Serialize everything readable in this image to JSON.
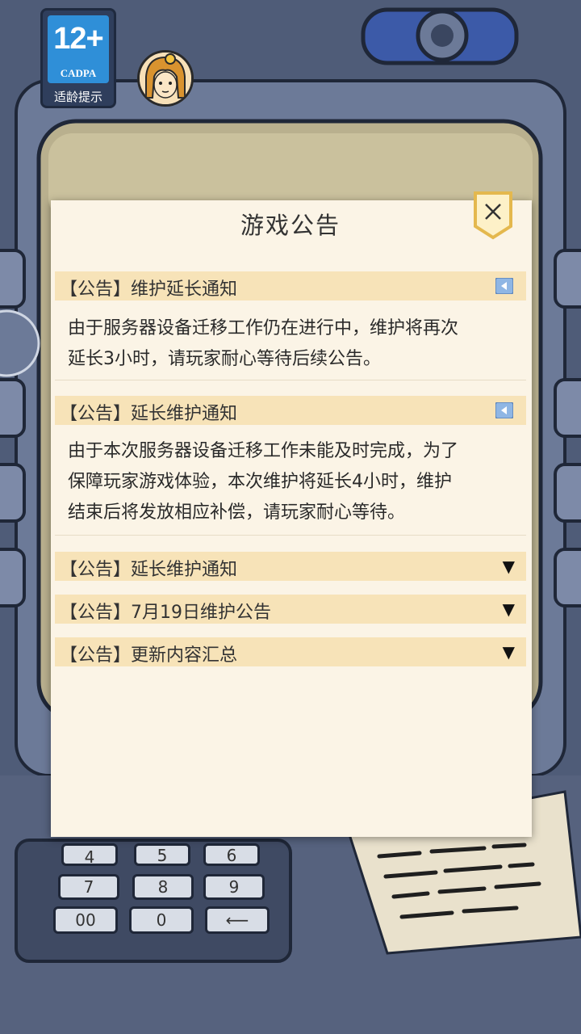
{
  "rating": {
    "age": "12+",
    "org": "CADPA",
    "tip": "适龄提示"
  },
  "dialog": {
    "title": "游戏公告",
    "close_icon": "close-x-icon",
    "notices": [
      {
        "title": "【公告】维护延长通知",
        "expanded": true,
        "indicator_icon": "collapse-left-icon",
        "body": [
          "由于服务器设备迁移工作仍在进行中，维护将再次",
          "延长3小时，请玩家耐心等待后续公告。"
        ]
      },
      {
        "title": "【公告】延长维护通知",
        "expanded": true,
        "indicator_icon": "collapse-left-icon",
        "body": [
          "由于本次服务器设备迁移工作未能及时完成，为了",
          "保障玩家游戏体验，本次维护将延长4小时，维护",
          "结束后将发放相应补偿，请玩家耐心等待。"
        ]
      },
      {
        "title": "【公告】延长维护通知",
        "expanded": false,
        "indicator": "▼"
      },
      {
        "title": "【公告】7月19日维护公告",
        "expanded": false,
        "indicator": "▼"
      },
      {
        "title": "【公告】更新内容汇总",
        "expanded": false,
        "indicator": "▼"
      }
    ]
  },
  "keypad": {
    "keys": [
      "4",
      "5",
      "6",
      "7",
      "8",
      "9",
      "00",
      "0",
      "⟵"
    ]
  },
  "colors": {
    "dialog_bg": "#fbf4e6",
    "header_bg": "#f7e3b8",
    "badge_blue": "#2f8fd8",
    "game_bg": "#5d6b88"
  }
}
